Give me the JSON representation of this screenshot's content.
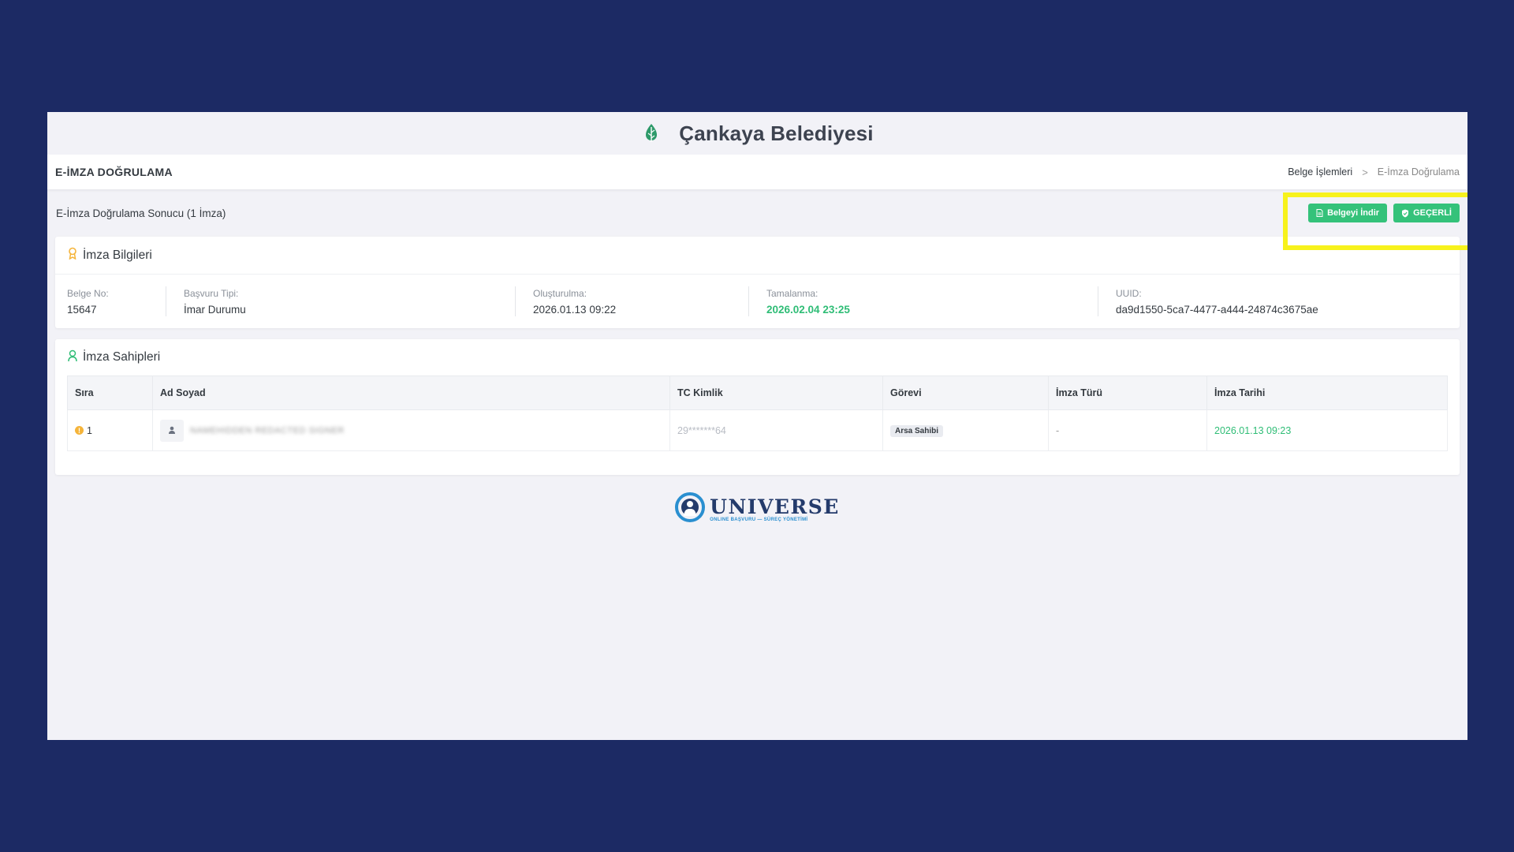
{
  "header": {
    "app_title": "Çankaya Belediyesi",
    "logo_icon": "leaf-logo-icon"
  },
  "page": {
    "title": "E-İMZA DOĞRULAMA",
    "breadcrumb": [
      "Belge İşlemleri",
      ">",
      "E-İmza Doğrulama"
    ]
  },
  "result": {
    "title": "E-İmza Doğrulama Sonucu (1 İmza)",
    "download_label": "Belgeyi İndir",
    "status_label": "GEÇERLİ"
  },
  "signature_info": {
    "heading": "İmza Bilgileri",
    "fields": [
      {
        "label": "Belge No:",
        "value": "15647"
      },
      {
        "label": "Başvuru Tipi:",
        "value": "İmar Durumu"
      },
      {
        "label": "Oluşturulma:",
        "value": "2026.01.13 09:22"
      },
      {
        "label": "Tamalanma:",
        "value": "2026.02.04 23:25"
      },
      {
        "label": "UUID:",
        "value": "da9d1550-5ca7-4477-a444-24874c3675ae"
      }
    ]
  },
  "signers": {
    "heading": "İmza Sahipleri",
    "columns": [
      "Sıra",
      "Ad Soyad",
      "TC Kimlik",
      "Görevi",
      "İmza Türü",
      "İmza Tarihi"
    ],
    "rows": [
      {
        "sira": "1",
        "name": "NAMEHIDDEN REDACTED SIGNER",
        "tc": "29*******64",
        "role": "Arsa Sahibi",
        "type": "-",
        "date": "2026.01.13 09:23"
      }
    ]
  },
  "footer": {
    "brand": "UNIVERSE",
    "tagline": "ONLINE BAŞVURU — SÜREÇ YÖNETİMİ"
  },
  "colors": {
    "background": "#1c2a64",
    "accent_green": "#34c27a",
    "highlight": "#f7f21c"
  }
}
